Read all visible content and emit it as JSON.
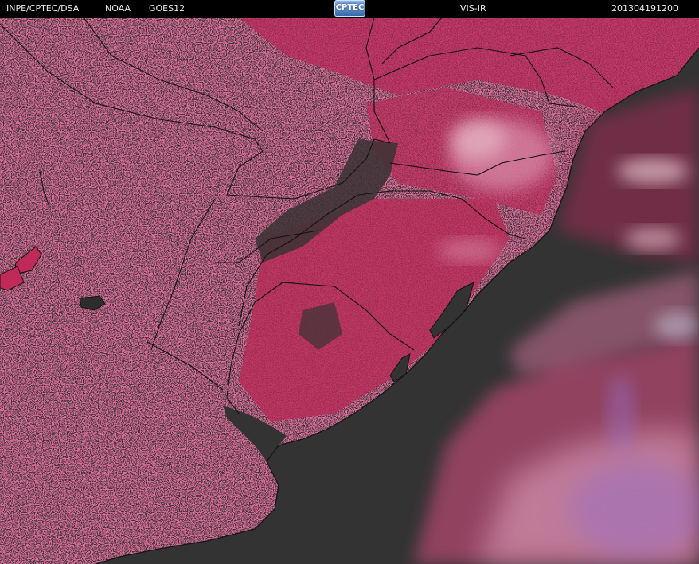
{
  "header": {
    "organization": "INPE/CPTEC/DSA",
    "agency": "NOAA",
    "satellite": "GOES12",
    "logo_text": "CPTEC",
    "product": "VIS-IR",
    "timestamp": "201304191200"
  },
  "colors": {
    "header_background": "#000000",
    "header_text": "#e8e8e8",
    "ocean": "#333333",
    "land_cloud": "#c02a58",
    "high_cloud": "#d98aa8",
    "cold_top": "#9a6fc4",
    "border_lines": "#111111"
  }
}
